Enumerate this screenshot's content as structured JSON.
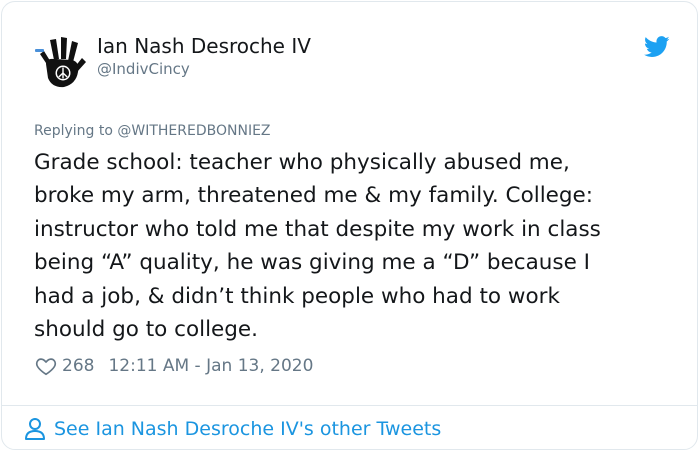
{
  "author": {
    "name": "Ian Nash Desroche IV",
    "handle": "@IndivCincy",
    "avatar_icon": "handprint-peace-icon"
  },
  "brand": {
    "icon": "twitter-bird-icon",
    "color": "#1da1f2"
  },
  "tweet": {
    "replying_to": "Replying to @WITHEREDBONNIEZ",
    "lines": [
      "Grade school: teacher who physically abused me,",
      "broke my arm, threatened me & my family. College:",
      "instructor who told me that despite my work in class",
      "being “A” quality, he was giving me a “D” because I",
      "had a job, & didn’t think people who had to work",
      "should go to college."
    ],
    "likes": "268",
    "timestamp": "12:11 AM - Jan 13, 2020"
  },
  "footer": {
    "label": "See Ian Nash Desroche IV's other Tweets",
    "icon": "person-icon",
    "color": "#1b95e0"
  }
}
